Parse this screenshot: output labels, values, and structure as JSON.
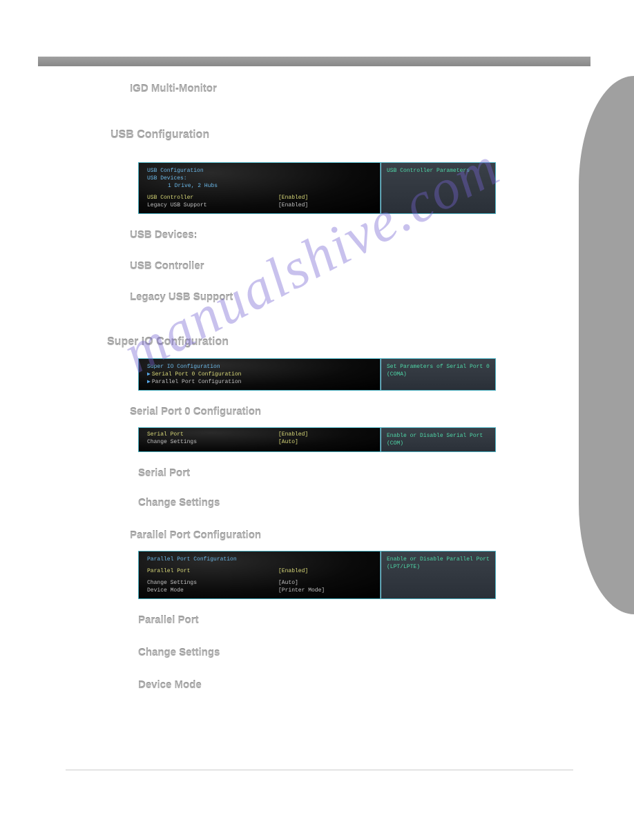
{
  "watermark": "manualshive.com",
  "headings": {
    "igd": "IGD Multi-Monitor",
    "usb_config": "USB Configuration",
    "usb_devices": "USB Devices:",
    "usb_controller": "USB Controller",
    "legacy_usb": "Legacy USB Support",
    "super_io": "Super IO Configuration",
    "serial0": "Serial Port 0 Configuration",
    "serial_port": "Serial Port",
    "change_settings": "Change Settings",
    "parallel_config": "Parallel Port Configuration",
    "parallel_port": "Parallel Port",
    "change_settings2": "Change Settings",
    "device_mode": "Device Mode"
  },
  "panel_usb": {
    "title": "USB Configuration",
    "devices_label": "USB Devices:",
    "devices_value": "1 Drive, 2 Hubs",
    "rows": [
      {
        "label": "USB Controller",
        "value": "[Enabled]"
      },
      {
        "label": "Legacy USB Support",
        "value": "[Enabled]"
      }
    ],
    "help": "USB Controller Parameters"
  },
  "panel_superio": {
    "title": "Super IO Configuration",
    "rows": [
      {
        "label": "Serial Port 0 Configuration"
      },
      {
        "label": "Parallel Port Configuration"
      }
    ],
    "help": "Set Parameters of Serial Port 0 (COMA)"
  },
  "panel_serial": {
    "rows": [
      {
        "label": "Serial Port",
        "value": "[Enabled]"
      },
      {
        "label": "Change Settings",
        "value": "[Auto]"
      }
    ],
    "help": "Enable or Disable Serial Port (COM)"
  },
  "panel_parallel": {
    "title": "Parallel Port Configuration",
    "row1": {
      "label": "Parallel Port",
      "value": "[Enabled]"
    },
    "rows": [
      {
        "label": "Change Settings",
        "value": "[Auto]"
      },
      {
        "label": "Device Mode",
        "value": "[Printer Mode]"
      }
    ],
    "help": "Enable or Disable Parallel Port (LPT/LPTE)"
  }
}
